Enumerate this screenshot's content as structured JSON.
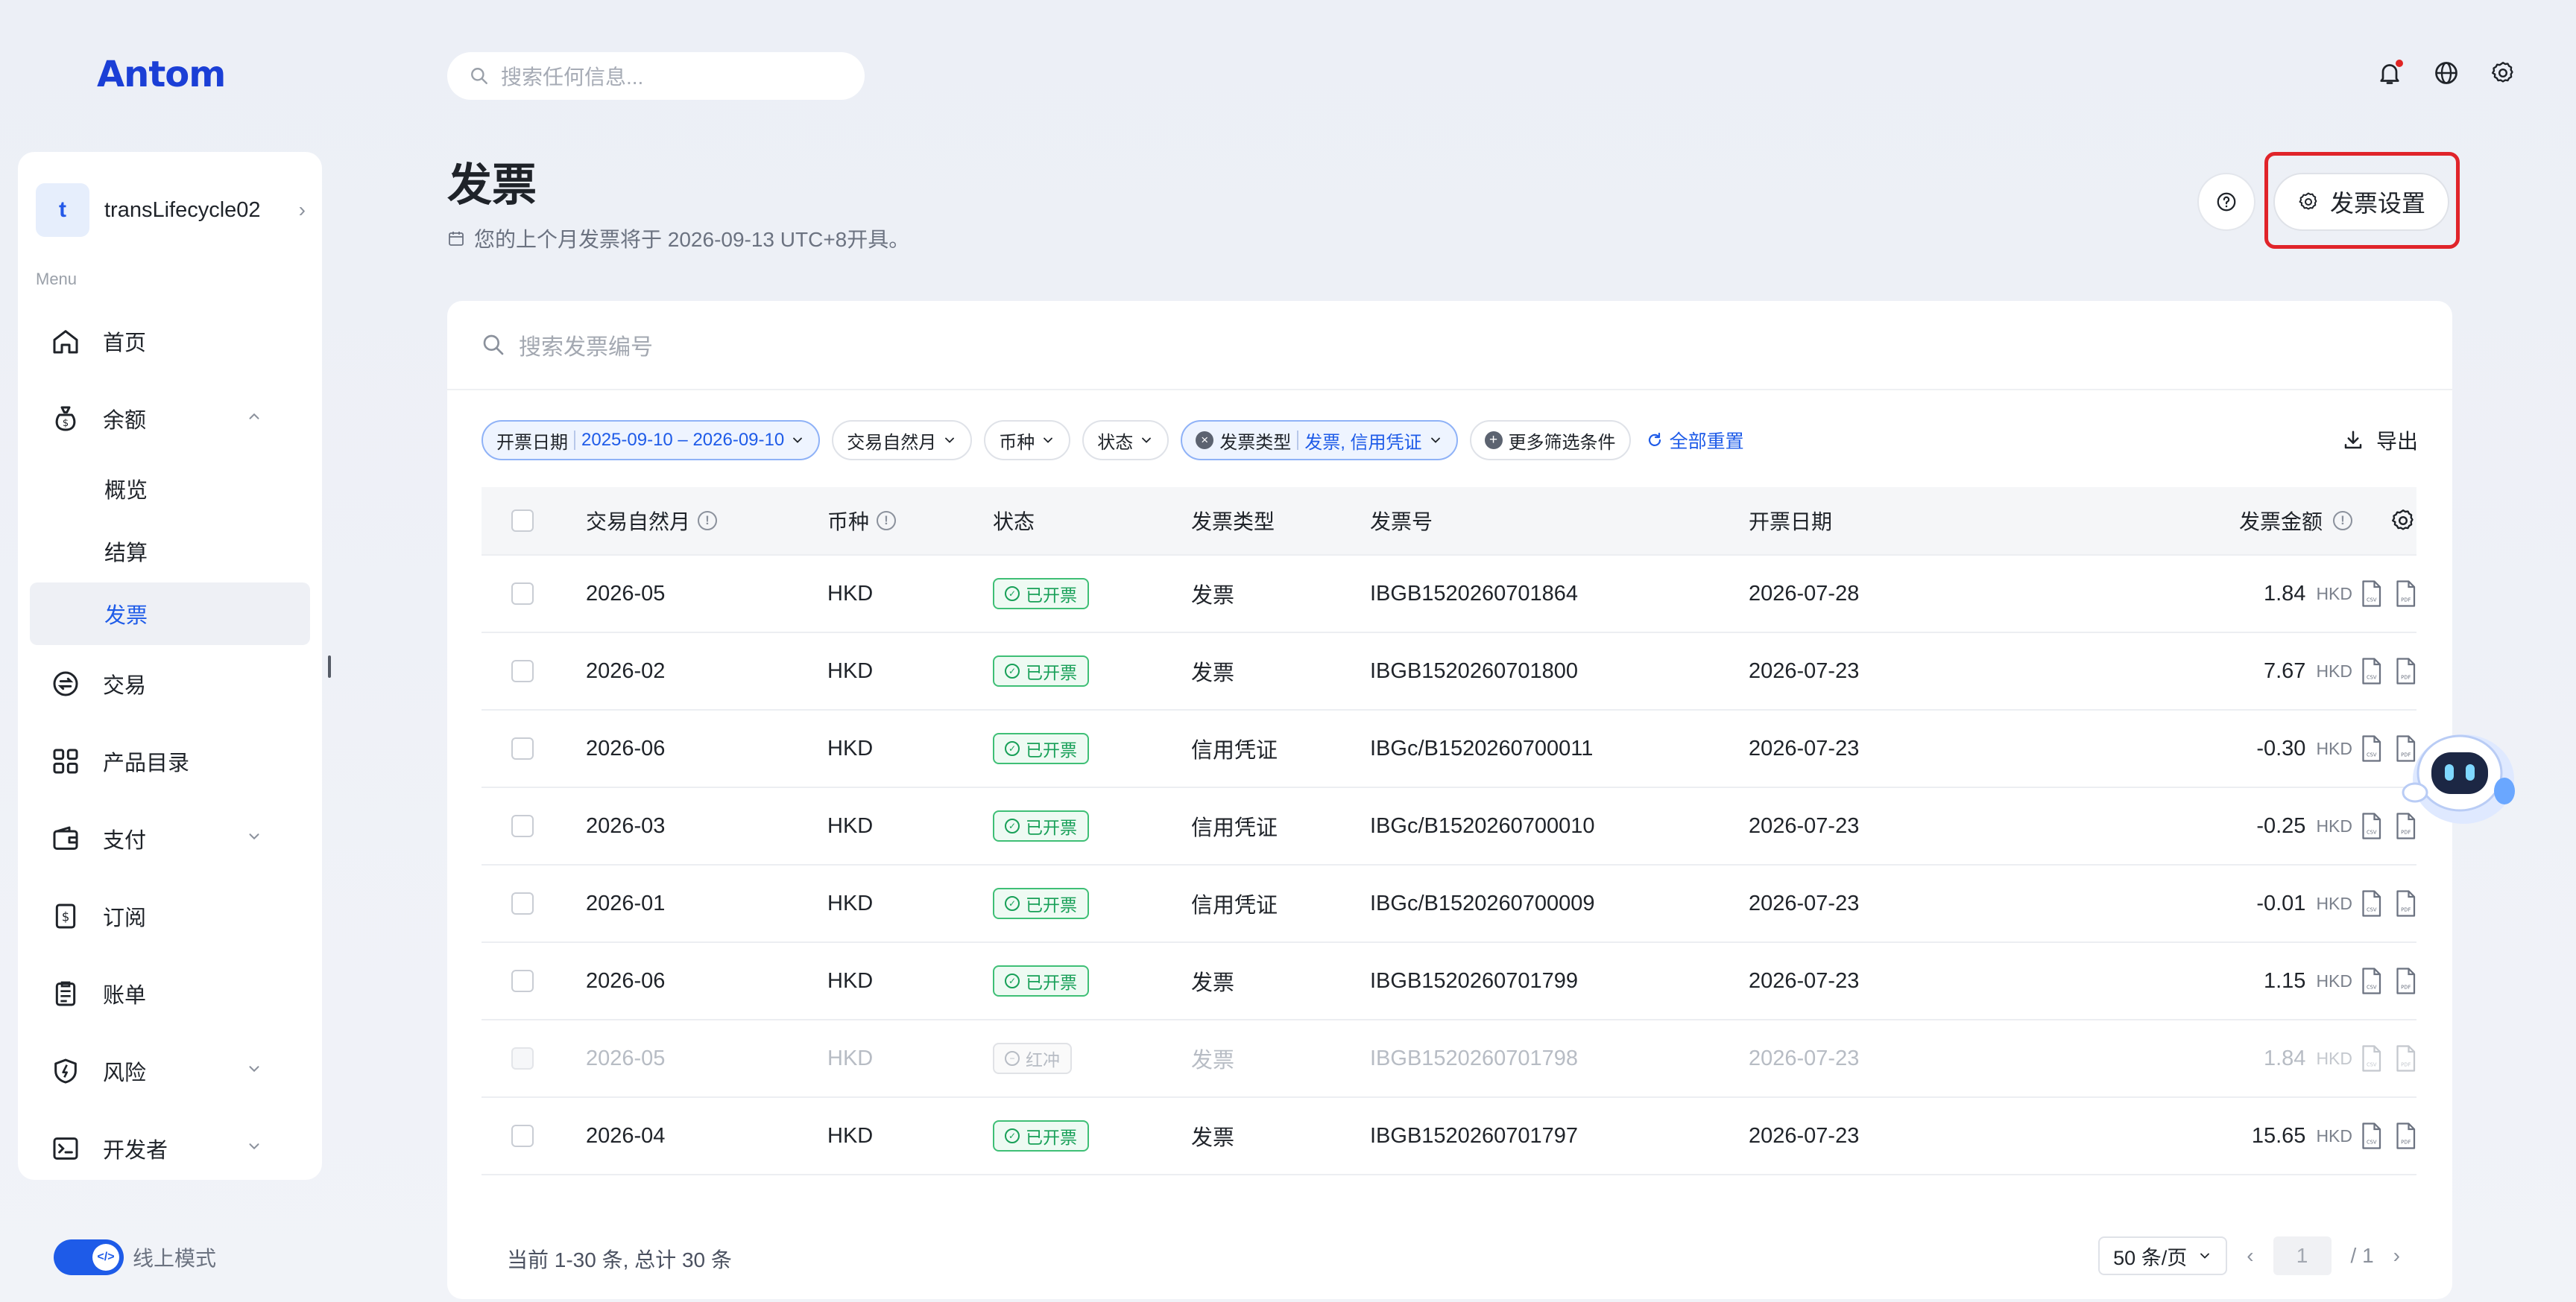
{
  "brand": {
    "logo_text": "Antom"
  },
  "topbar": {
    "search_placeholder": "搜索任何信息..."
  },
  "account": {
    "initial": "t",
    "name": "transLifecycle02"
  },
  "sidebar": {
    "menu_label": "Menu",
    "items": [
      {
        "label": "首页"
      },
      {
        "label": "余额"
      },
      {
        "label": "概览"
      },
      {
        "label": "结算"
      },
      {
        "label": "发票"
      },
      {
        "label": "交易"
      },
      {
        "label": "产品目录"
      },
      {
        "label": "支付"
      },
      {
        "label": "订阅"
      },
      {
        "label": "账单"
      },
      {
        "label": "风险"
      },
      {
        "label": "开发者"
      }
    ],
    "mode_label": "线上模式"
  },
  "page": {
    "title": "发票",
    "subtitle": "您的上个月发票将于 2026-09-13 UTC+8开具。",
    "settings_button": "发票设置"
  },
  "search": {
    "placeholder": "搜索发票编号"
  },
  "filters": {
    "date_label": "开票日期",
    "date_value": "2025-09-10 – 2026-09-10",
    "month_label": "交易自然月",
    "currency_label": "币种",
    "status_label": "状态",
    "type_label": "发票类型",
    "type_value": "发票, 信用凭证",
    "more_label": "更多筛选条件",
    "reset_label": "全部重置",
    "export_label": "导出"
  },
  "table": {
    "headers": {
      "month": "交易自然月",
      "currency": "币种",
      "status": "状态",
      "type": "发票类型",
      "number": "发票号",
      "date": "开票日期",
      "amount": "发票金额"
    },
    "rows": [
      {
        "month": "2026-05",
        "currency": "HKD",
        "status": "已开票",
        "type": "发票",
        "number": "IBGB1520260701864",
        "date": "2026-07-28",
        "amount": "1.84",
        "unit": "HKD"
      },
      {
        "month": "2026-02",
        "currency": "HKD",
        "status": "已开票",
        "type": "发票",
        "number": "IBGB1520260701800",
        "date": "2026-07-23",
        "amount": "7.67",
        "unit": "HKD"
      },
      {
        "month": "2026-06",
        "currency": "HKD",
        "status": "已开票",
        "type": "信用凭证",
        "number": "IBGc/B1520260700011",
        "date": "2026-07-23",
        "amount": "-0.30",
        "unit": "HKD"
      },
      {
        "month": "2026-03",
        "currency": "HKD",
        "status": "已开票",
        "type": "信用凭证",
        "number": "IBGc/B1520260700010",
        "date": "2026-07-23",
        "amount": "-0.25",
        "unit": "HKD"
      },
      {
        "month": "2026-01",
        "currency": "HKD",
        "status": "已开票",
        "type": "信用凭证",
        "number": "IBGc/B1520260700009",
        "date": "2026-07-23",
        "amount": "-0.01",
        "unit": "HKD"
      },
      {
        "month": "2026-06",
        "currency": "HKD",
        "status": "已开票",
        "type": "发票",
        "number": "IBGB1520260701799",
        "date": "2026-07-23",
        "amount": "1.15",
        "unit": "HKD"
      },
      {
        "month": "2026-05",
        "currency": "HKD",
        "status": "红冲",
        "type": "发票",
        "number": "IBGB1520260701798",
        "date": "2026-07-23",
        "amount": "1.84",
        "unit": "HKD"
      },
      {
        "month": "2026-04",
        "currency": "HKD",
        "status": "已开票",
        "type": "发票",
        "number": "IBGB1520260701797",
        "date": "2026-07-23",
        "amount": "15.65",
        "unit": "HKD"
      }
    ]
  },
  "footer": {
    "summary": "当前 1-30 条, 总计 30 条",
    "page_size": "50 条/页",
    "current_page": "1",
    "total_pages": "/ 1"
  },
  "colors": {
    "accent": "#1e5be8",
    "success": "#18a058",
    "highlight": "#e0242a"
  }
}
